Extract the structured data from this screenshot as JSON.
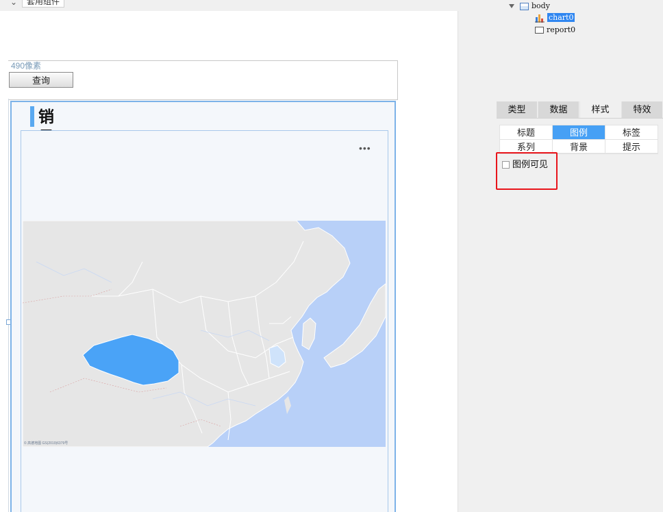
{
  "editor": {
    "top_tab_label": "套用组件",
    "param_hint": "490像素",
    "query_button": "查询",
    "widget_title": "销量概况",
    "more_label": "•••",
    "map_credit": "© 高德地图 GS(2019)6379号",
    "highlighted_region": "西藏",
    "colors": {
      "highlight_region": "#4aa3f7",
      "land": "#e6e6e6",
      "sea": "#b8d0f8",
      "accent_bar": "#5aa9f0"
    }
  },
  "tree": {
    "items": [
      {
        "label": "body",
        "icon": "form-icon"
      },
      {
        "label": "chart0",
        "icon": "chart-icon",
        "selected": true
      },
      {
        "label": "report0",
        "icon": "report-icon"
      }
    ]
  },
  "properties": {
    "main_tabs": [
      "类型",
      "数据",
      "样式",
      "特效"
    ],
    "active_main_tab": "样式",
    "sub_tabs": [
      "标题",
      "图例",
      "标签",
      "系列",
      "背景",
      "提示"
    ],
    "active_sub_tab": "图例",
    "legend_visible_label": "图例可见",
    "legend_visible_checked": false,
    "highlight_color": "#e8141a"
  }
}
